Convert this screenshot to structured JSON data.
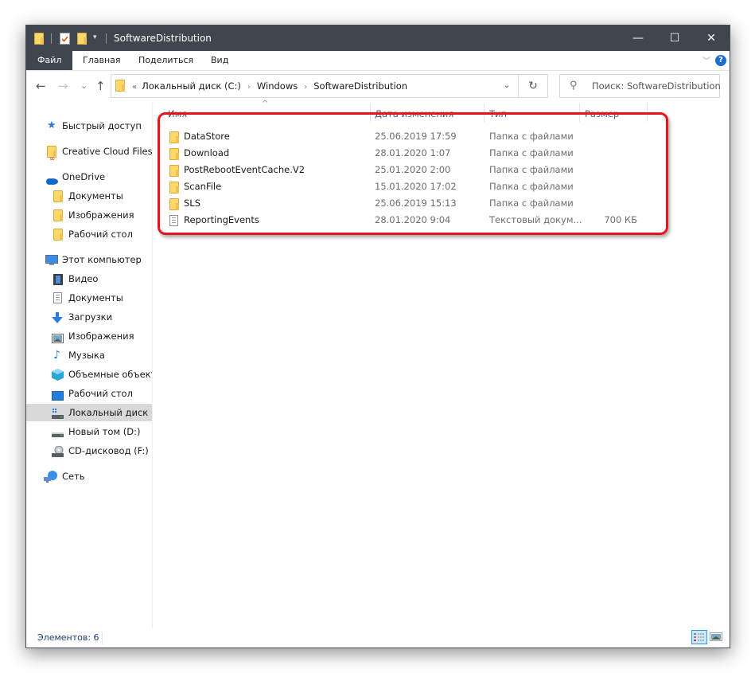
{
  "window": {
    "title": "SoftwareDistribution",
    "controls": {
      "minimize": "—",
      "maximize": "☐",
      "close": "✕"
    }
  },
  "ribbon": {
    "tabs": [
      {
        "label": "Файл"
      },
      {
        "label": "Главная"
      },
      {
        "label": "Поделиться"
      },
      {
        "label": "Вид"
      }
    ],
    "help": "?"
  },
  "navigation": {
    "back": "←",
    "forward": "→",
    "recent": "⌄",
    "up": "↑",
    "address": {
      "overflow": "«",
      "crumbs": [
        "Локальный диск (C:)",
        "Windows",
        "SoftwareDistribution"
      ],
      "separator": "›"
    },
    "refresh": "↻",
    "search_placeholder": "Поиск: SoftwareDistribution"
  },
  "sidebar": {
    "items": [
      {
        "label": "Быстрый доступ",
        "icon": "star-icon"
      },
      {
        "label": "Creative Cloud Files",
        "icon": "creative-cloud-folder-icon"
      },
      {
        "label": "OneDrive",
        "icon": "cloud-icon"
      },
      {
        "label": "Документы",
        "icon": "folder-icon"
      },
      {
        "label": "Изображения",
        "icon": "folder-icon"
      },
      {
        "label": "Рабочий стол",
        "icon": "folder-icon"
      },
      {
        "label": "Этот компьютер",
        "icon": "computer-icon"
      },
      {
        "label": "Видео",
        "icon": "video-icon"
      },
      {
        "label": "Документы",
        "icon": "document-icon"
      },
      {
        "label": "Загрузки",
        "icon": "download-icon"
      },
      {
        "label": "Изображения",
        "icon": "pictures-icon"
      },
      {
        "label": "Музыка",
        "icon": "music-icon"
      },
      {
        "label": "Объемные объект",
        "icon": "3d-objects-icon"
      },
      {
        "label": "Рабочий стол",
        "icon": "desktop-icon"
      },
      {
        "label": "Локальный диск (C",
        "icon": "system-drive-icon",
        "selected": true
      },
      {
        "label": "Новый том (D:)",
        "icon": "drive-icon"
      },
      {
        "label": "CD-дисковод (F:)",
        "icon": "cd-drive-icon"
      },
      {
        "label": "Сеть",
        "icon": "network-icon"
      }
    ]
  },
  "file_list": {
    "columns": [
      "Имя",
      "Дата изменения",
      "Тип",
      "Размер"
    ],
    "rows": [
      {
        "name": "DataStore",
        "date": "25.06.2019 17:59",
        "type": "Папка с файлами",
        "size": "",
        "icon": "folder-icon"
      },
      {
        "name": "Download",
        "date": "28.01.2020 1:07",
        "type": "Папка с файлами",
        "size": "",
        "icon": "folder-icon"
      },
      {
        "name": "PostRebootEventCache.V2",
        "date": "25.01.2020 2:00",
        "type": "Папка с файлами",
        "size": "",
        "icon": "folder-icon"
      },
      {
        "name": "ScanFile",
        "date": "15.01.2020 17:02",
        "type": "Папка с файлами",
        "size": "",
        "icon": "folder-icon"
      },
      {
        "name": "SLS",
        "date": "25.06.2019 15:13",
        "type": "Папка с файлами",
        "size": "",
        "icon": "folder-icon"
      },
      {
        "name": "ReportingEvents",
        "date": "28.01.2020 9:04",
        "type": "Текстовый докум...",
        "size": "700 КБ",
        "icon": "text-file-icon"
      }
    ]
  },
  "status": {
    "items_count": "Элементов: 6"
  },
  "colors": {
    "titlebar": "#40464f",
    "highlight": "#e8141b",
    "selection": "#d9d9d9",
    "accent": "#1c6fd1"
  }
}
